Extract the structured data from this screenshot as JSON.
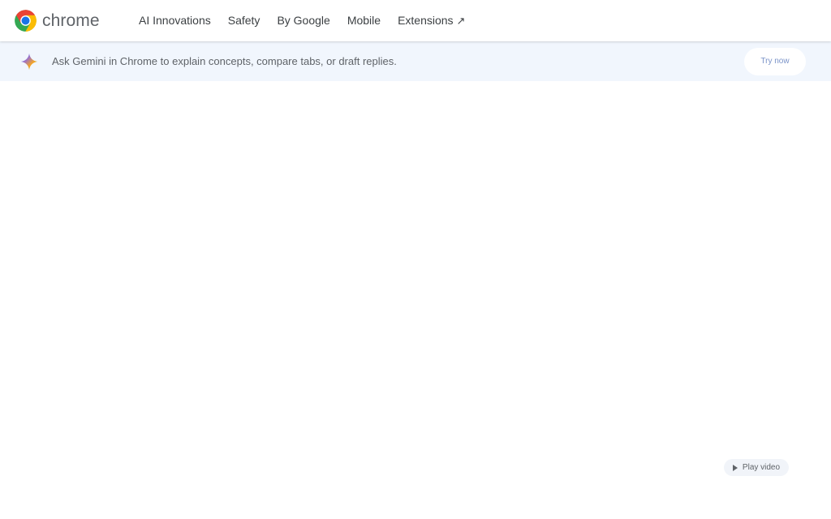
{
  "header": {
    "brand_name": "chrome",
    "brand_icon": "chrome-logo-icon",
    "nav": [
      {
        "label": "AI Innovations"
      },
      {
        "label": "Safety"
      },
      {
        "label": "By Google"
      },
      {
        "label": "Mobile"
      },
      {
        "label": "Extensions",
        "icon": "external-link-arrow-icon",
        "glyph": "↗"
      }
    ]
  },
  "banner": {
    "icon": "gemini-sparkle-icon",
    "text": "Ask Gemini in Chrome to explain concepts, compare tabs, or draft replies.",
    "cta_label": "Try now"
  },
  "video": {
    "icon": "play-icon",
    "label": "Play video"
  },
  "colors": {
    "banner_background": "#f1f6fd",
    "cta_text": "#7a93c8",
    "nav_text": "#3c4043"
  }
}
